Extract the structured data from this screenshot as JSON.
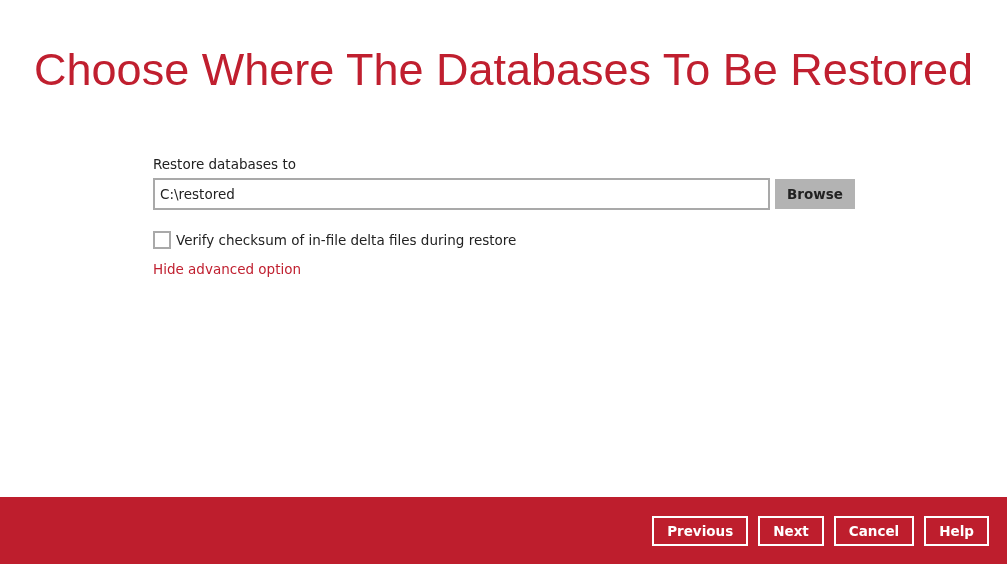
{
  "title": "Choose Where The Databases To Be Restored",
  "restore_to": {
    "label": "Restore databases to",
    "value": "C:\\restored",
    "browse_button": "Browse"
  },
  "verify_checksum": {
    "label": "Verify checksum of in-file delta files during restore",
    "checked": false
  },
  "advanced_link": "Hide advanced option",
  "buttons": [
    "Previous",
    "Next",
    "Cancel",
    "Help"
  ]
}
